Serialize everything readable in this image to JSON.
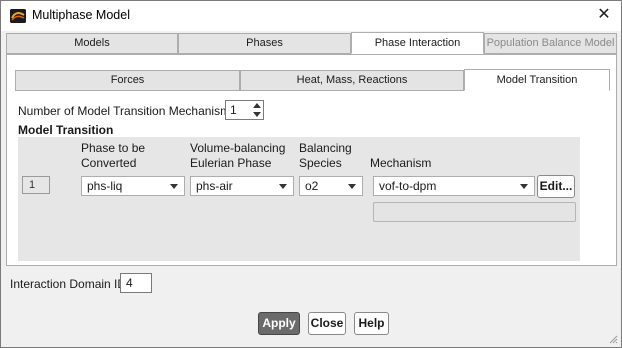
{
  "window": {
    "title": "Multiphase Model"
  },
  "tabs": {
    "models": "Models",
    "phases": "Phases",
    "phase_interaction": "Phase Interaction",
    "population_balance": "Population Balance Model"
  },
  "subtabs": {
    "forces": "Forces",
    "heat_mass": "Heat, Mass, Reactions",
    "model_transition": "Model Transition"
  },
  "mechanisms": {
    "label": "Number of Model Transition Mechanisms",
    "value": "1"
  },
  "section": {
    "title": "Model Transition"
  },
  "columns": {
    "phase_line1": "Phase to be",
    "phase_line2": "Converted",
    "vol_line1": "Volume-balancing",
    "vol_line2": "Eulerian Phase",
    "bal_line1": "Balancing",
    "bal_line2": "Species",
    "mechanism": "Mechanism"
  },
  "row": {
    "index": "1",
    "phase": "phs-liq",
    "vol_phase": "phs-air",
    "species": "o2",
    "mechanism": "vof-to-dpm",
    "edit_label": "Edit..."
  },
  "domain": {
    "label": "Interaction Domain ID",
    "value": "4"
  },
  "buttons": {
    "apply": "Apply",
    "close": "Close",
    "help": "Help"
  },
  "colors": {
    "active_tab": "#ffffff",
    "primary_button": "#6b6b6b"
  }
}
